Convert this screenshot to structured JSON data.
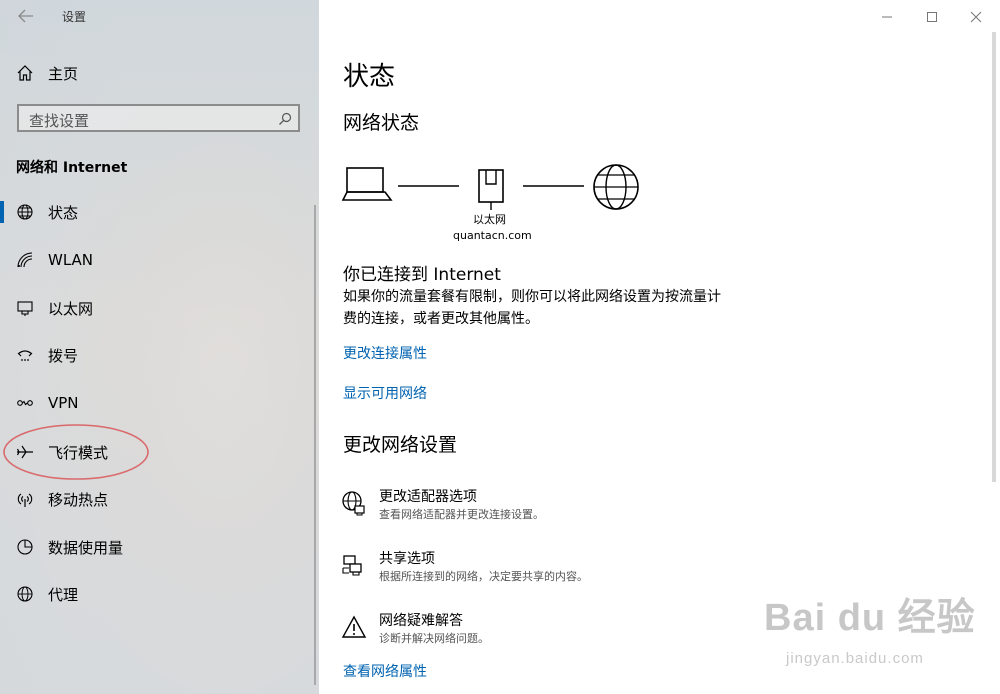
{
  "app": {
    "title": "设置"
  },
  "sidebar": {
    "home_label": "主页",
    "search_placeholder": "查找设置",
    "section_title": "网络和 Internet",
    "items": [
      {
        "label": "状态",
        "icon": "globe-icon",
        "selected": true
      },
      {
        "label": "WLAN",
        "icon": "wifi-icon"
      },
      {
        "label": "以太网",
        "icon": "ethernet-icon"
      },
      {
        "label": "拨号",
        "icon": "dialup-icon"
      },
      {
        "label": "VPN",
        "icon": "vpn-icon"
      },
      {
        "label": "飞行模式",
        "icon": "airplane-icon"
      },
      {
        "label": "移动热点",
        "icon": "hotspot-icon"
      },
      {
        "label": "数据使用量",
        "icon": "data-usage-icon"
      },
      {
        "label": "代理",
        "icon": "proxy-globe-icon"
      }
    ]
  },
  "main": {
    "title": "状态",
    "network_status": "网络状态",
    "diagram": {
      "adapter_label": "以太网",
      "network_name": "quantacn.com"
    },
    "connected_title": "你已连接到 Internet",
    "connected_desc_line1": "如果你的流量套餐有限制，则你可以将此网络设置为按流量计",
    "connected_desc_line2": "费的连接，或者更改其他属性。",
    "link_change_props": "更改连接属性",
    "link_show_networks": "显示可用网络",
    "change_settings": "更改网络设置",
    "options": [
      {
        "title": "更改适配器选项",
        "desc": "查看网络适配器并更改连接设置。",
        "icon": "adapter-globe-icon"
      },
      {
        "title": "共享选项",
        "desc": "根据所连接到的网络，决定要共享的内容。",
        "icon": "sharing-icon"
      },
      {
        "title": "网络疑难解答",
        "desc": "诊断并解决网络问题。",
        "icon": "warning-icon"
      }
    ],
    "link_view_props": "查看网络属性"
  },
  "watermark": {
    "brand": "Bai du 经验",
    "url": "jingyan.baidu.com"
  },
  "colors": {
    "accent": "#0063b1",
    "annotation": "#d9262a"
  }
}
